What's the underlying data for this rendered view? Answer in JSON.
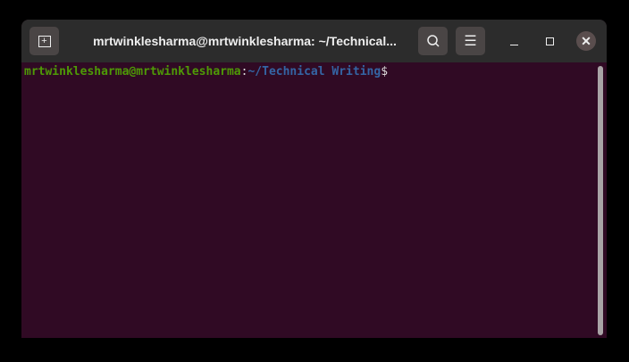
{
  "window": {
    "title": "mrtwinklesharma@mrtwinklesharma: ~/Technical..."
  },
  "prompt": {
    "user_host": "mrtwinklesharma@mrtwinklesharma",
    "separator": ":",
    "path": "~/Technical Writing",
    "symbol": "$"
  },
  "colors": {
    "background": "#300a24",
    "user_host": "#4e9a06",
    "path": "#3465a4"
  }
}
